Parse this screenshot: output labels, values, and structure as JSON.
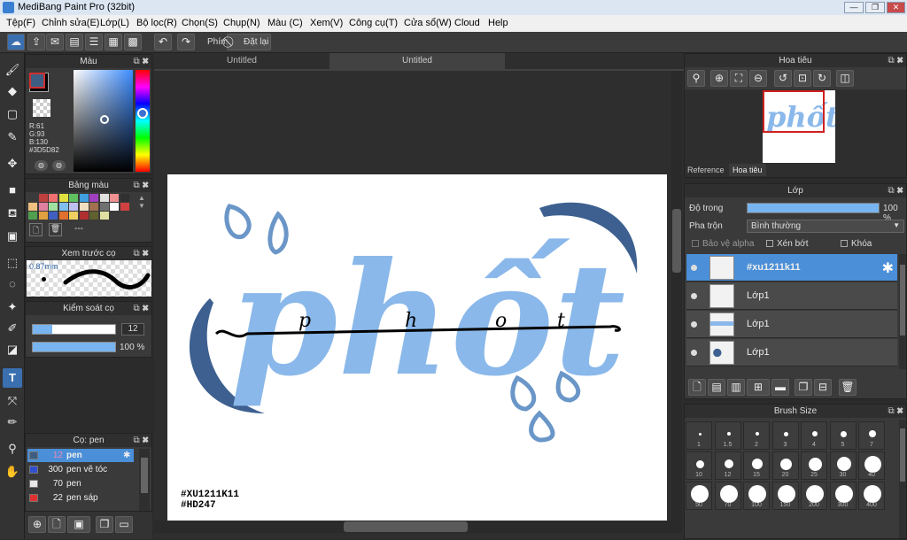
{
  "app": {
    "title": "MediBang Paint Pro (32bit)"
  },
  "menu": [
    "Tệp(F)",
    "Chỉnh sửa(E)",
    "Lớp(L)",
    "Bộ lọc(R)",
    "Chọn(S)",
    "Chụp(N)",
    "Màu (C)",
    "Xem(V)",
    "Công cụ(T)",
    "Cửa sổ(W)",
    "Cloud",
    "Help"
  ],
  "toolbar": {
    "shortcut_label": "Phím",
    "reset_label": "Đặt lại"
  },
  "tabs": [
    "Untitled",
    "Untitled"
  ],
  "color_panel": {
    "title": "Màu",
    "r": "R:61",
    "g": "G:93",
    "b": "B:130",
    "hex": "#3D5D82",
    "fg": "#3D5D82",
    "bg": "#000000"
  },
  "palette_panel": {
    "title": "Bảng màu",
    "colors": [
      "#3a3a3a",
      "#c04040",
      "#f07070",
      "#e0e040",
      "#60c060",
      "#40a0e0",
      "#a040c0",
      "#e0e0e0",
      "#f09090",
      "#303030",
      "#f0c080",
      "#e080a0",
      "#a0e0a0",
      "#80c0f0",
      "#c0c0f0",
      "#f0e0c0",
      "#a07050",
      "#707070",
      "#ffffff",
      "#d04040",
      "#50a050",
      "#e0a040",
      "#4060c0",
      "#e07030",
      "#f0d060",
      "#b03030",
      "#606030",
      "#e0e0a0"
    ],
    "empty_label": "---"
  },
  "brush_preview_panel": {
    "title": "Xem trước cọ",
    "size": "0.87mm"
  },
  "brush_control_panel": {
    "title": "Kiểm soát cọ",
    "size_value": "12",
    "opacity_value": "100 %",
    "size_fraction": 0.12,
    "opacity_fraction": 1.0
  },
  "brush_list_panel": {
    "title": "Cọ: pen",
    "items": [
      {
        "size": "12",
        "name": "pen",
        "color": "#3D5D82",
        "selected": true
      },
      {
        "size": "300",
        "name": "pen vẽ tóc",
        "color": "#3050d0",
        "selected": false
      },
      {
        "size": "70",
        "name": "pen",
        "color": "#e8e8e8",
        "selected": false
      },
      {
        "size": "22",
        "name": "pen sáp",
        "color": "#e03030",
        "selected": false
      }
    ]
  },
  "artwork": {
    "main_text": "phốt",
    "line_letters": [
      "p",
      "h",
      "o",
      "t"
    ],
    "tag1": "#XU1211K11",
    "tag2": "#HD247"
  },
  "navigator_panel": {
    "title": "Hoa tiêu",
    "tabs": [
      "Reference",
      "Hoa tiêu"
    ]
  },
  "layer_panel": {
    "title": "Lớp",
    "opacity_label": "Độ trong",
    "opacity_value": "100 %",
    "opacity_fraction": 1.0,
    "blend_label": "Pha trộn",
    "blend_value": "Bình thường",
    "protect_alpha": "Bảo vệ alpha",
    "clipping": "Xén bớt",
    "lock": "Khóa",
    "layers": [
      {
        "name": "#xu1211k11",
        "selected": true
      },
      {
        "name": "Lớp1",
        "selected": false
      },
      {
        "name": "Lớp1",
        "selected": false
      },
      {
        "name": "Lớp1",
        "selected": false
      }
    ]
  },
  "brush_size_panel": {
    "title": "Brush Size",
    "sizes": [
      "1",
      "1.5",
      "2",
      "3",
      "4",
      "5",
      "7",
      "10",
      "12",
      "15",
      "20",
      "25",
      "30",
      "40",
      "50",
      "70",
      "100",
      "150",
      "200",
      "300",
      "400"
    ]
  }
}
